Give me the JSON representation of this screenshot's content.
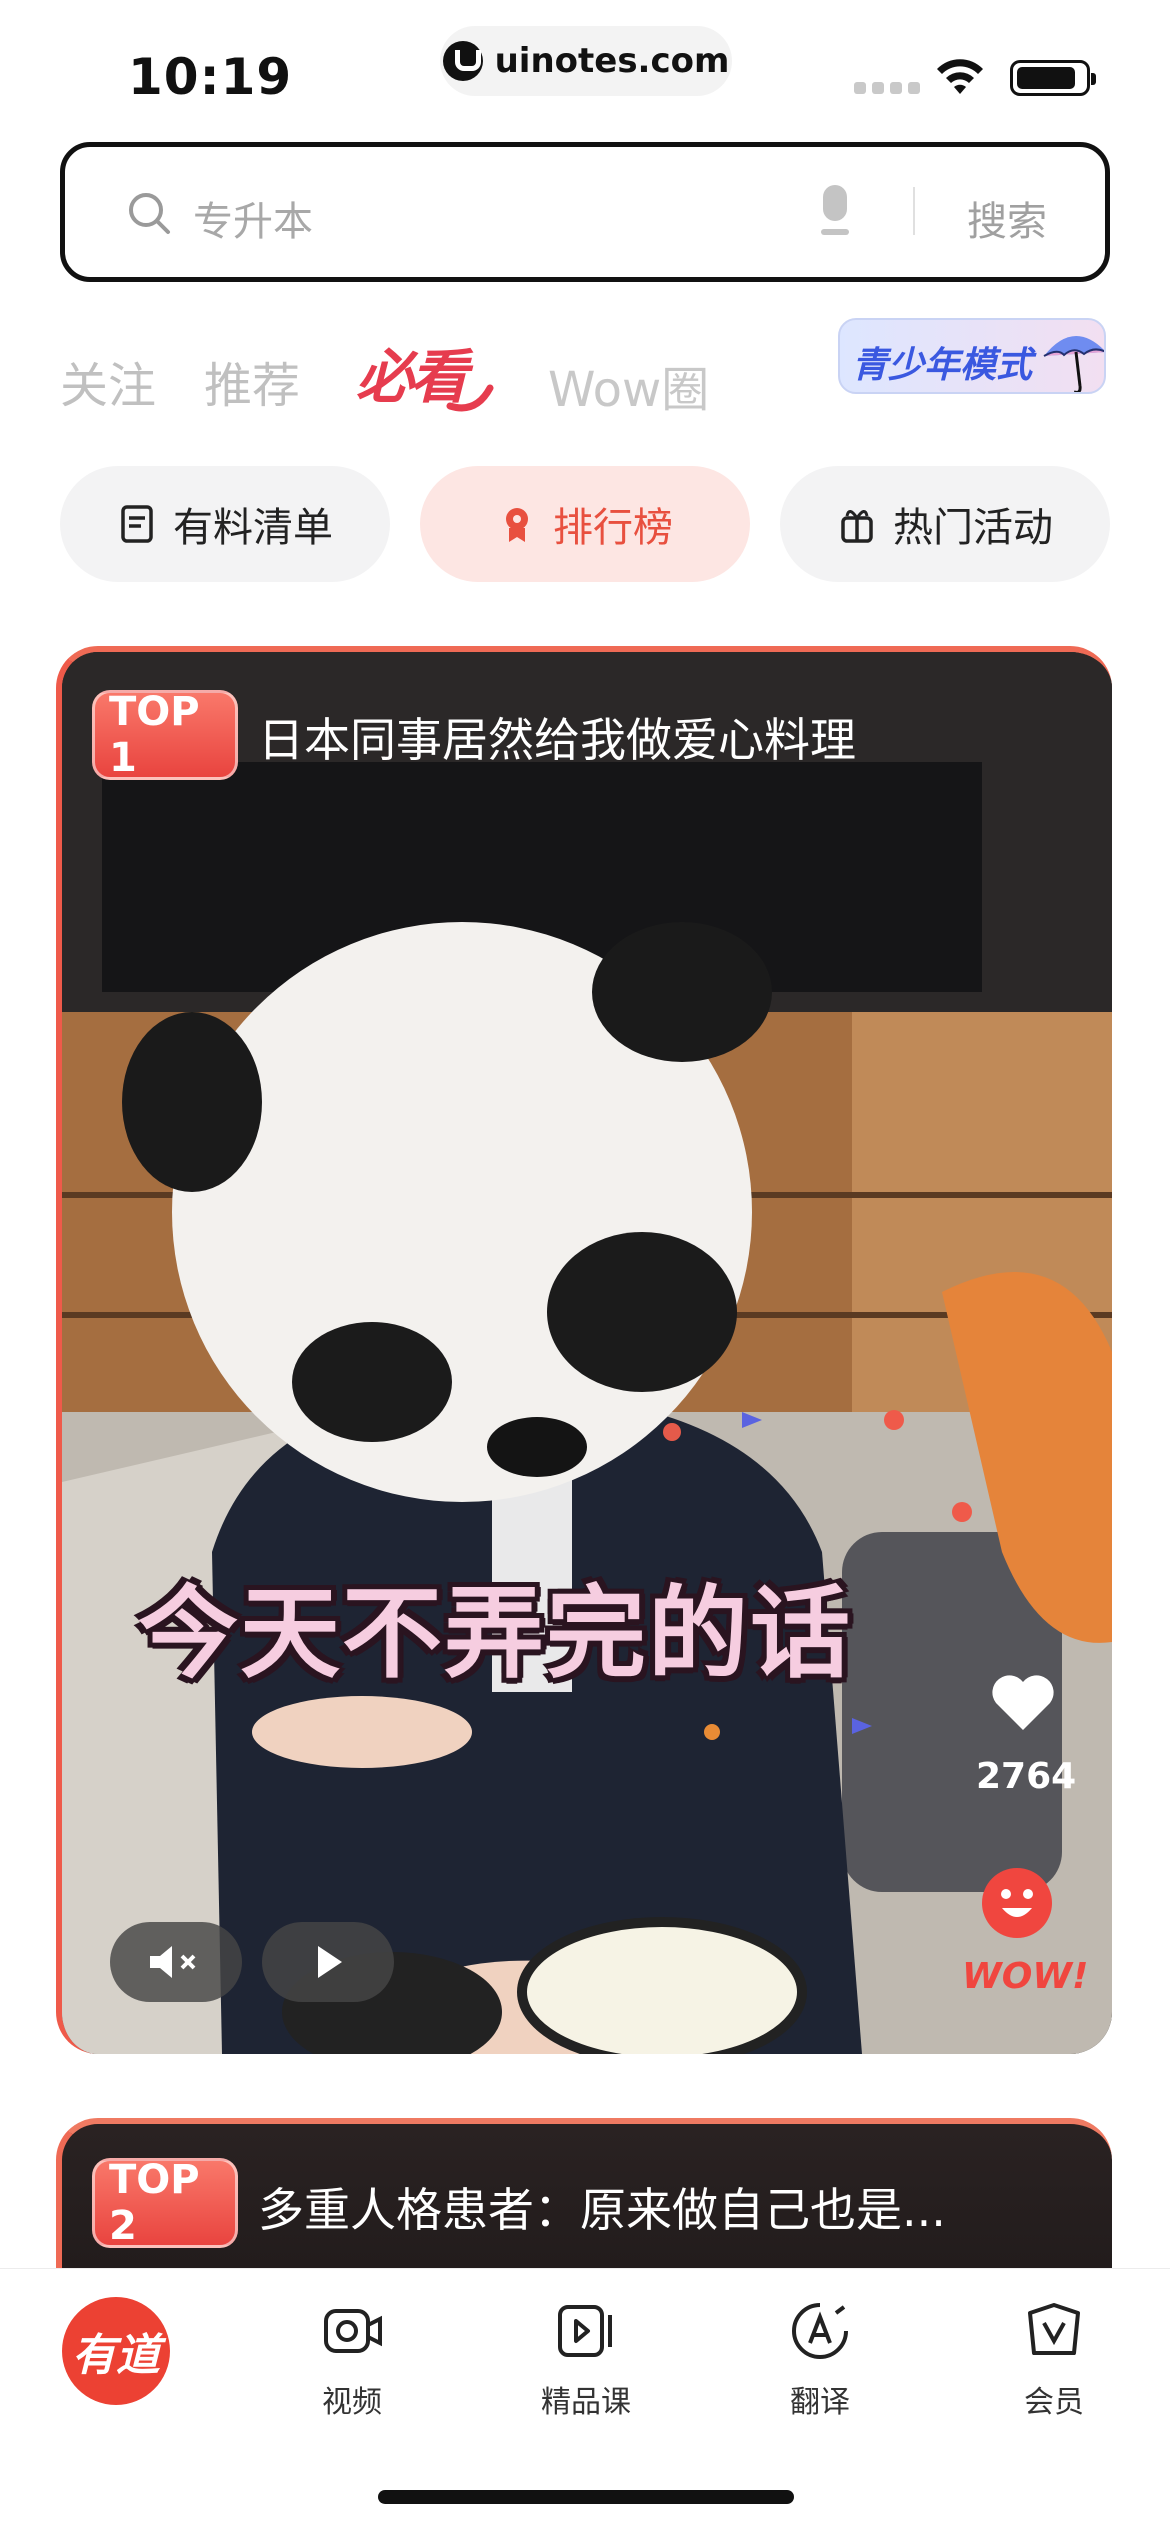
{
  "status_bar": {
    "time": "10:19",
    "url": "uinotes.com"
  },
  "search": {
    "placeholder": "专升本",
    "button_label": "搜索"
  },
  "top_tabs": [
    {
      "label": "关注"
    },
    {
      "label": "推荐"
    },
    {
      "label": "必看"
    },
    {
      "label": "Wow圈"
    }
  ],
  "youth_mode": {
    "label": "青少年模式"
  },
  "chips": [
    {
      "label": "有料清单",
      "icon": "list-doc-icon"
    },
    {
      "label": "排行榜",
      "icon": "ribbon-medal-icon"
    },
    {
      "label": "热门活动",
      "icon": "gift-icon"
    }
  ],
  "cards": [
    {
      "rank": "TOP 1",
      "title": "日本同事居然给我做爱心料理",
      "overlay_subtitle": "今天不弄完的话",
      "likes": "2764",
      "reaction": "WOW!"
    },
    {
      "rank": "TOP 2",
      "title": "多重人格患者：原来做自己也是..."
    }
  ],
  "tabbar": {
    "brand": "有道",
    "items": [
      {
        "label": "视频",
        "icon": "video-camera-icon"
      },
      {
        "label": "精品课",
        "icon": "course-play-icon"
      },
      {
        "label": "翻译",
        "icon": "translate-icon"
      },
      {
        "label": "会员",
        "icon": "vip-bag-icon"
      }
    ]
  },
  "colors": {
    "accent": "#E8503F",
    "badge": "#EF5A4A",
    "chip_active_bg": "#FDE6E3",
    "youth_blue": "#3A58E0"
  }
}
